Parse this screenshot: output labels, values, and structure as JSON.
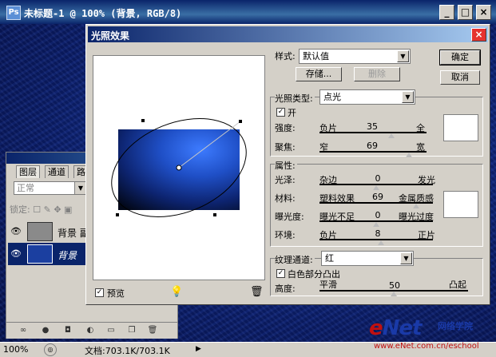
{
  "document": {
    "title": "未标题-1 @ 100% (背景, RGB/8)",
    "app_icon": "Ps",
    "minimize": "_",
    "maximize": "□",
    "close": "×"
  },
  "layers_panel": {
    "tabs": [
      "图层",
      "通道",
      "路"
    ],
    "blend_mode": "正常",
    "lock_label": "锁定:",
    "layers": [
      {
        "name": "背景 副",
        "visible": true,
        "thumb_color": "#8a8a8a"
      },
      {
        "name": "背景",
        "visible": true,
        "thumb_color": "#1b3fa0",
        "selected": true
      }
    ],
    "footer_icons": [
      "link-icon",
      "fx-icon",
      "mask-icon",
      "adjust-icon",
      "folder-icon",
      "new-layer-icon",
      "trash-icon"
    ]
  },
  "status_bar": {
    "zoom": "100%",
    "doc_info": "文档:703.1K/703.1K"
  },
  "watermark": {
    "brand_e": "e",
    "brand_rest": "Net",
    "cn": "网络学院",
    "url": "www.eNet.com.cn/eschool"
  },
  "dialog": {
    "title": "光照效果",
    "close": "×",
    "style_label": "样式:",
    "style_value": "默认值",
    "save_label": "存储...",
    "delete_label": "删除",
    "ok_label": "确定",
    "cancel_label": "取消",
    "preview_label": "预览",
    "light_type_label": "光照类型:",
    "light_type_value": "点光",
    "on_label": "开",
    "on_checked": true,
    "intensity": {
      "label": "强度:",
      "left": "负片",
      "value": "35",
      "right": "全",
      "fraction": 0.68
    },
    "focus": {
      "label": "聚焦:",
      "left": "窄",
      "value": "69",
      "right": "宽",
      "fraction": 0.85
    },
    "properties_label": "属性:",
    "gloss": {
      "label": "光泽:",
      "left": "杂边",
      "value": "0",
      "right": "发光",
      "fraction": 0.5
    },
    "material": {
      "label": "材料:",
      "left": "塑料效果",
      "value": "69",
      "right": "金属质感",
      "fraction": 0.85
    },
    "exposure": {
      "label": "曝光度:",
      "left": "曝光不足",
      "value": "0",
      "right": "曝光过度",
      "fraction": 0.5
    },
    "ambience": {
      "label": "环境:",
      "left": "负片",
      "value": "8",
      "right": "正片",
      "fraction": 0.54
    },
    "texture_channel_label": "纹理通道:",
    "texture_channel_value": "红",
    "white_high_label": "白色部分凸出",
    "white_high_checked": true,
    "height": {
      "label": "高度:",
      "left": "平滑",
      "value": "50",
      "right": "凸起",
      "fraction": 0.5
    },
    "light_color": "#ffffff",
    "ambient_color": "#ffffff"
  }
}
